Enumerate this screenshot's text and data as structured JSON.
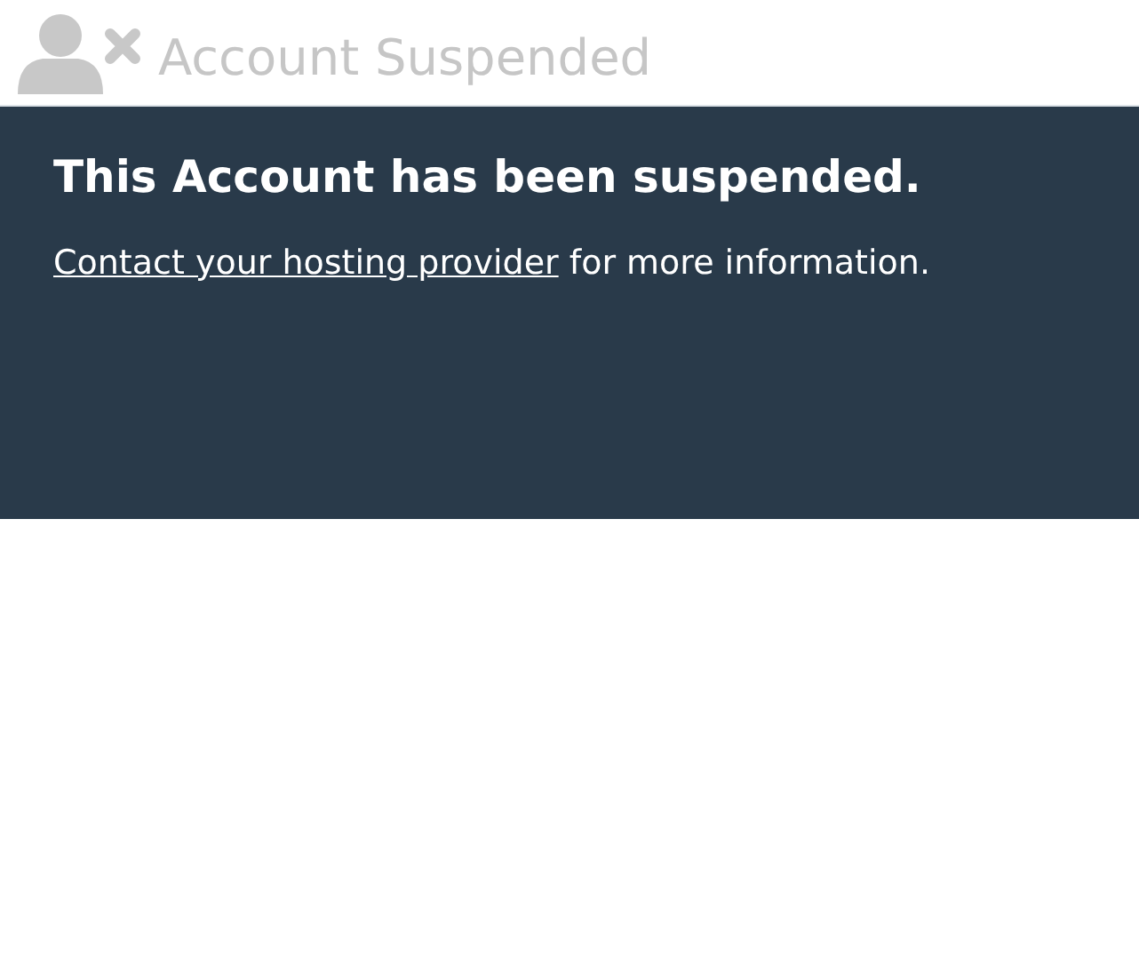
{
  "header": {
    "title": "Account Suspended"
  },
  "notice": {
    "heading": "This Account has been suspended.",
    "link": "Contact your hosting provider",
    "message": "for more information."
  }
}
